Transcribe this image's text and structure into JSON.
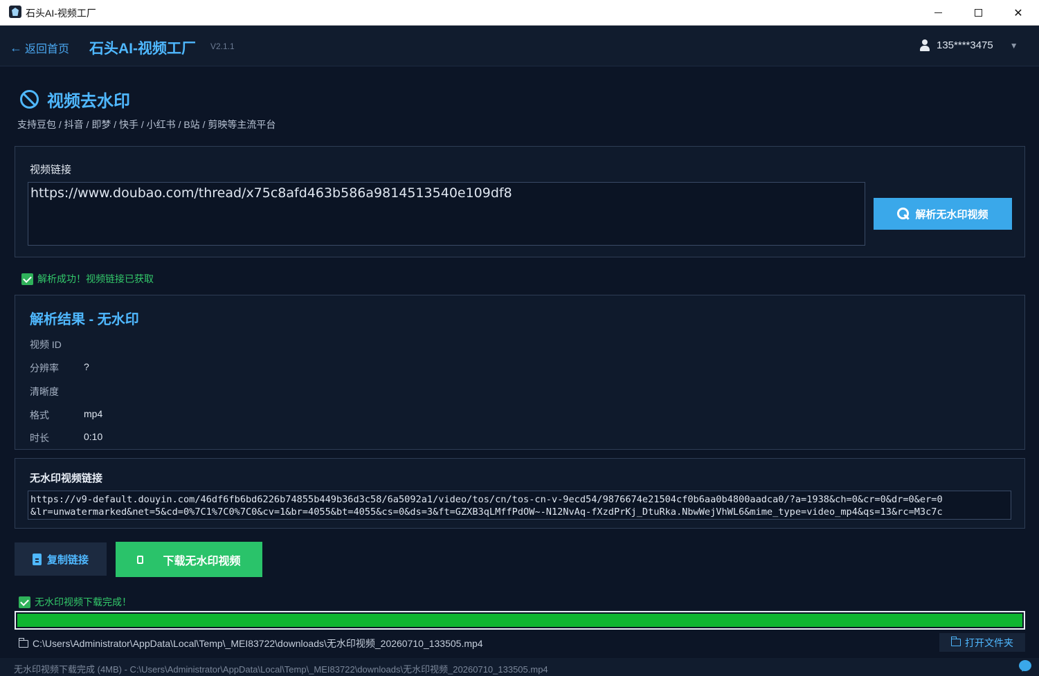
{
  "window": {
    "title": "石头AI-视频工厂",
    "close_glyph": "✕"
  },
  "header": {
    "back_arrow": "←",
    "back_label": "返回首页",
    "app_title": "石头AI-视频工厂",
    "version": "V2.1.1",
    "username": "135****3475",
    "caret": "▼"
  },
  "page": {
    "title": "视频去水印",
    "subtitle": "支持豆包 / 抖音 / 即梦 / 快手 / 小红书 / B站 / 剪映等主流平台"
  },
  "input_panel": {
    "label": "视频链接",
    "url_value": "https://www.doubao.com/thread/x75c8afd463b586a9814513540e109df8",
    "parse_button": "解析无水印视频"
  },
  "parse_status": "解析成功！视频链接已获取",
  "result": {
    "title": "解析结果 - 无水印",
    "rows": [
      {
        "key": "视频 ID",
        "value": ""
      },
      {
        "key": "分辨率",
        "value": "?"
      },
      {
        "key": "清晰度",
        "value": ""
      },
      {
        "key": "格式",
        "value": "mp4"
      },
      {
        "key": "时长",
        "value": "0:10"
      }
    ]
  },
  "link_panel": {
    "title": "无水印视频链接",
    "line1": "https://v9-default.douyin.com/46df6fb6bd6226b74855b449b36d3c58/6a5092a1/video/tos/cn/tos-cn-v-9ecd54/9876674e21504cf0b6aa0b4800aadca0/?a=1938&ch=0&cr=0&dr=0&er=0",
    "line2": "&lr=unwatermarked&net=5&cd=0%7C1%7C0%7C0&cv=1&br=4055&bt=4055&cs=0&ds=3&ft=GZXB3qLMffPdOW~-N12NvAq-fXzdPrKj_DtuRka.NbwWejVhWL6&mime_type=video_mp4&qs=13&rc=M3c7c"
  },
  "actions": {
    "copy_label": "复制链接",
    "download_label": "下载无水印视频"
  },
  "download_status": "无水印视频下载完成！",
  "progress": {
    "percent": 100,
    "color": "#0fb531"
  },
  "file_path": "C:\\Users\\Administrator\\AppData\\Local\\Temp\\_MEI83722\\downloads\\无水印视频_20260710_133505.mp4",
  "open_folder_label": "打开文件夹",
  "statusbar": "无水印视频下载完成 (4MB) - C:\\Users\\Administrator\\AppData\\Local\\Temp\\_MEI83722\\downloads\\无水印视频_20260710_133505.mp4",
  "colors": {
    "accent": "#4fb8ff",
    "success": "#2ac36a",
    "background": "#0c1526"
  }
}
